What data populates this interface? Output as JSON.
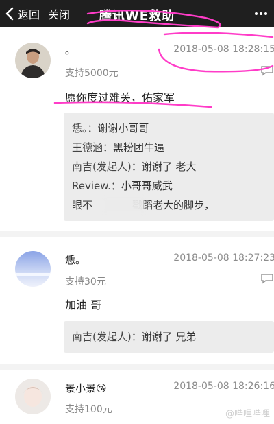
{
  "header": {
    "back_label": "返回",
    "close_label": "关闭",
    "title": "腾讯WE救助"
  },
  "comments": [
    {
      "name": "。",
      "time": "2018-05-08 18:28:15",
      "support": "支持5000元",
      "text": "愿你度过难关，佑家军",
      "replies": [
        {
          "who": "恁。：",
          "msg": "谢谢小哥哥"
        },
        {
          "who": "王德涵：",
          "msg": "黑粉团牛逼"
        },
        {
          "who": "南吉(发起人)：",
          "msg": "谢谢了 老大"
        },
        {
          "who": "Review.：",
          "msg": "小哥哥威武"
        },
        {
          "who": "眼不",
          "msg": "戳蹈老大的脚步，"
        }
      ]
    },
    {
      "name": "恁。",
      "time": "2018-05-08 18:27:23",
      "support": "支持30元",
      "text": "加油 哥",
      "replies": [
        {
          "who": "南吉(发起人)：",
          "msg": "谢谢了 兄弟"
        }
      ]
    },
    {
      "name": "景小景😘",
      "time": "2018-05-08 18:26:16",
      "support": "支持100元"
    }
  ],
  "watermark": "@哔哩哔哩",
  "colors": {
    "header_bg": "#1f1f1f",
    "highlight": "#ff3cc8",
    "reply_bg": "#ececec"
  }
}
